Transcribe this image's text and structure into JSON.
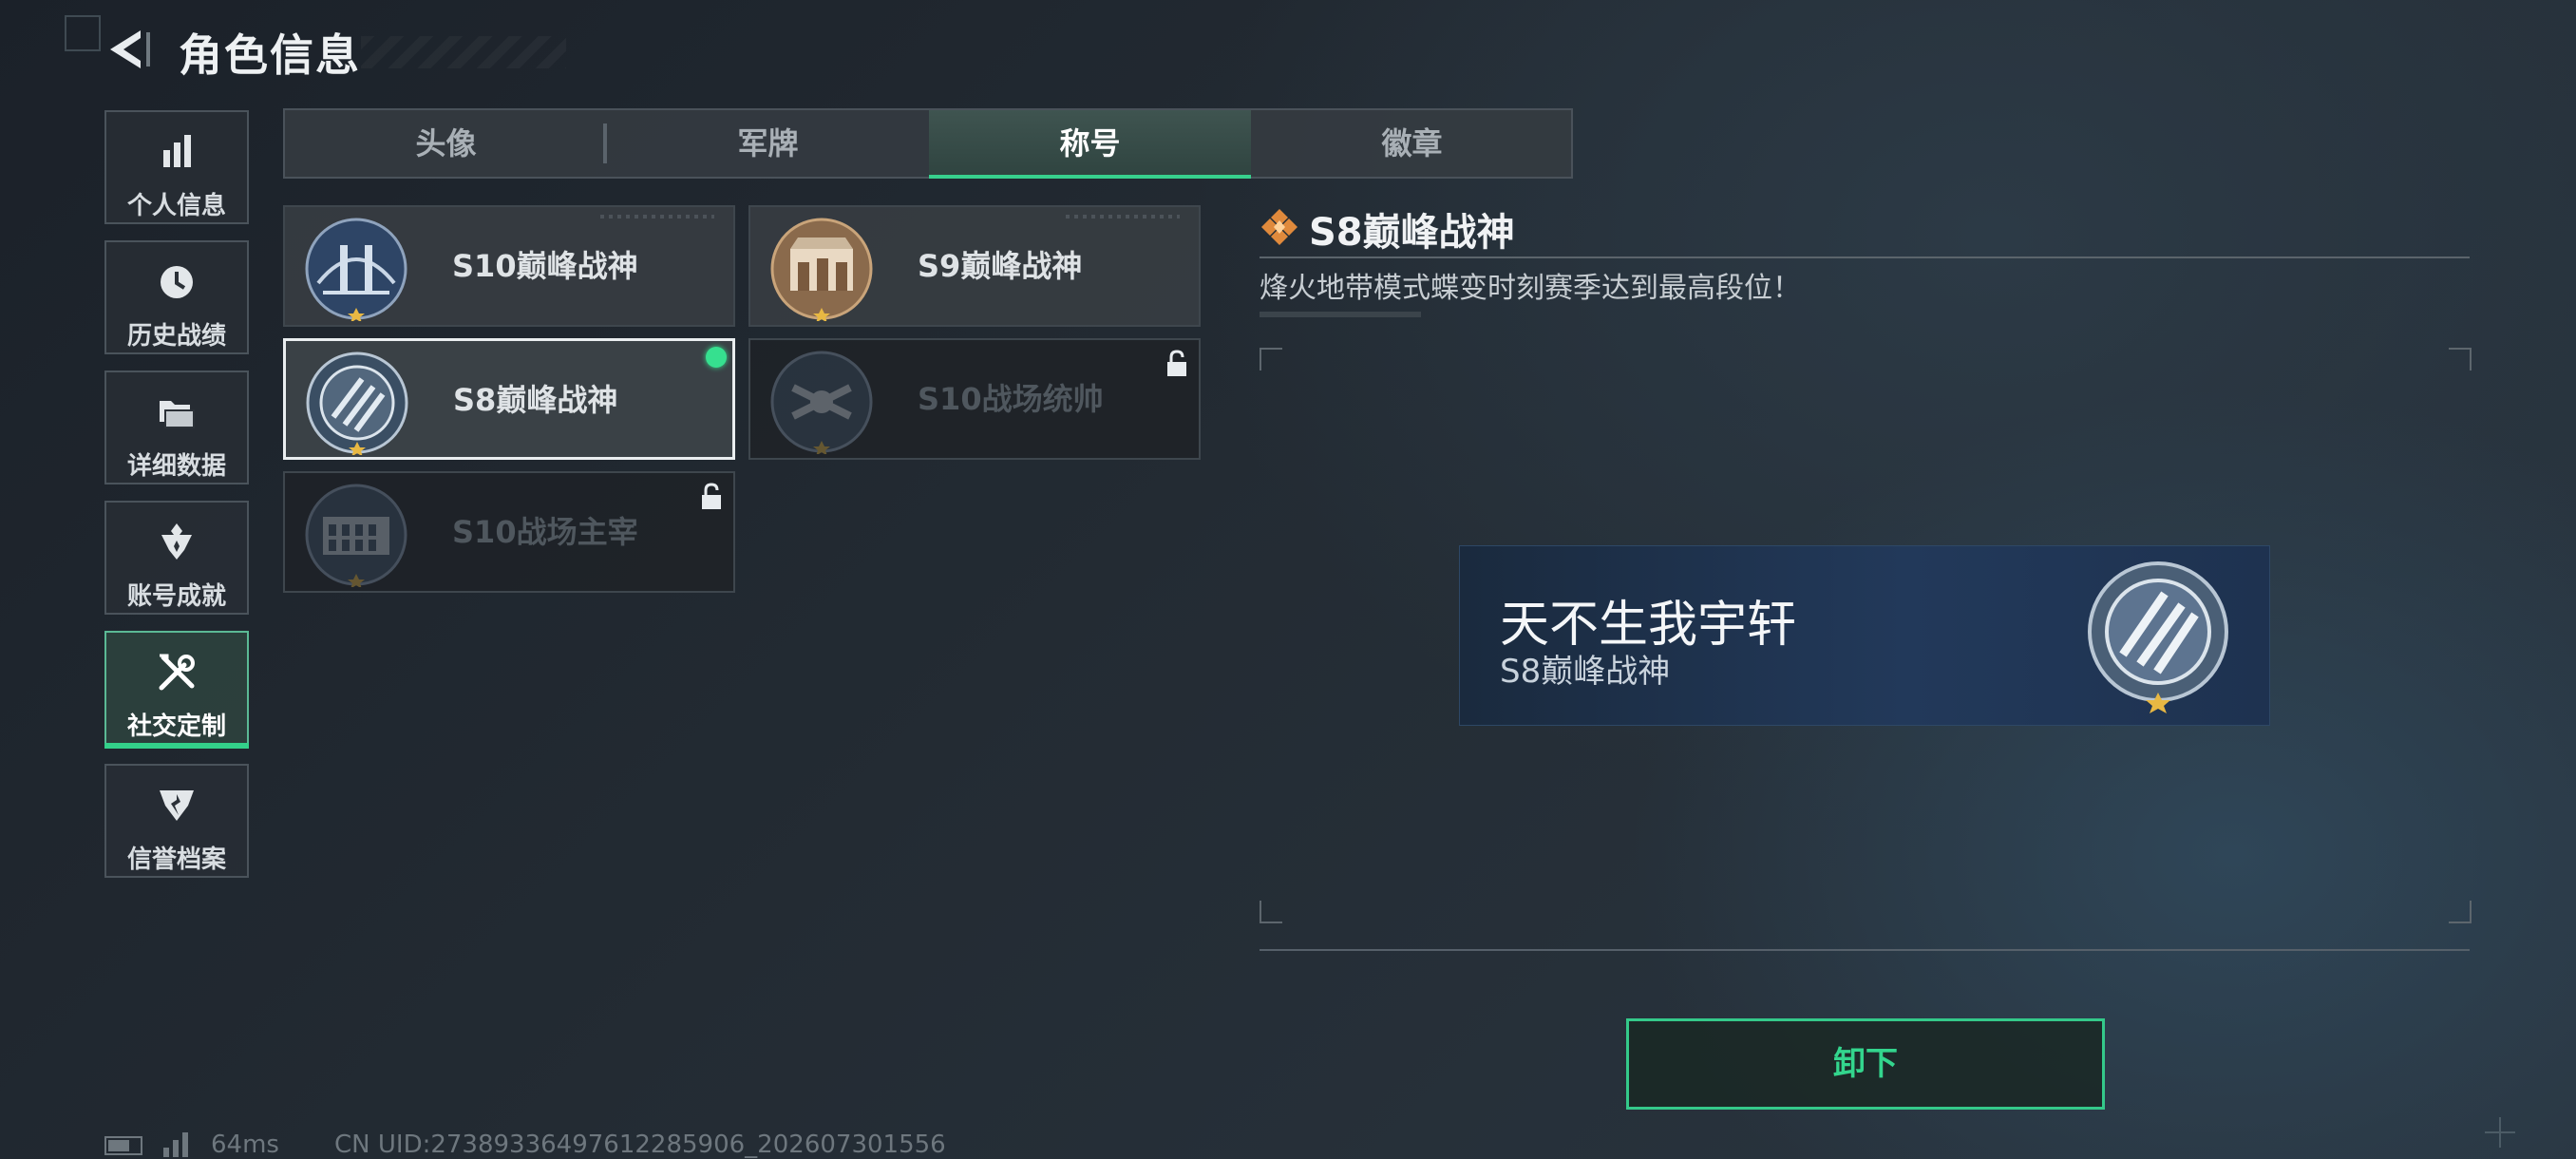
{
  "header": {
    "title": "角色信息"
  },
  "nav": {
    "items": [
      {
        "label": "个人信息",
        "icon": "bar-chart-icon"
      },
      {
        "label": "历史战绩",
        "icon": "clock-icon"
      },
      {
        "label": "详细数据",
        "icon": "folder-icon"
      },
      {
        "label": "账号成就",
        "icon": "achievement-icon"
      },
      {
        "label": "社交定制",
        "icon": "tools-icon",
        "active": true
      },
      {
        "label": "信誉档案",
        "icon": "shield-wing-icon"
      }
    ]
  },
  "tabs": [
    {
      "label": "头像"
    },
    {
      "label": "军牌"
    },
    {
      "label": "称号",
      "active": true
    },
    {
      "label": "徽章"
    }
  ],
  "titles": [
    {
      "label": "S10巅峰战神",
      "state": "owned"
    },
    {
      "label": "S9巅峰战神",
      "state": "owned"
    },
    {
      "label": "S8巅峰战神",
      "state": "equipped"
    },
    {
      "label": "S10战场统帅",
      "state": "locked"
    },
    {
      "label": "S10战场主宰",
      "state": "locked"
    }
  ],
  "detail": {
    "title": "S8巅峰战神",
    "description": "烽火地带模式蝶变时刻赛季达到最高段位！"
  },
  "preview": {
    "player_name": "天不生我宇轩",
    "title": "S8巅峰战神"
  },
  "action": {
    "unequip_label": "卸下"
  },
  "status": {
    "ping": "64ms",
    "uid": "CN UID:27389336497612285906_202607301556"
  },
  "colors": {
    "accent": "#33d58d",
    "panel": "#373d43",
    "background": "#1f262e"
  }
}
